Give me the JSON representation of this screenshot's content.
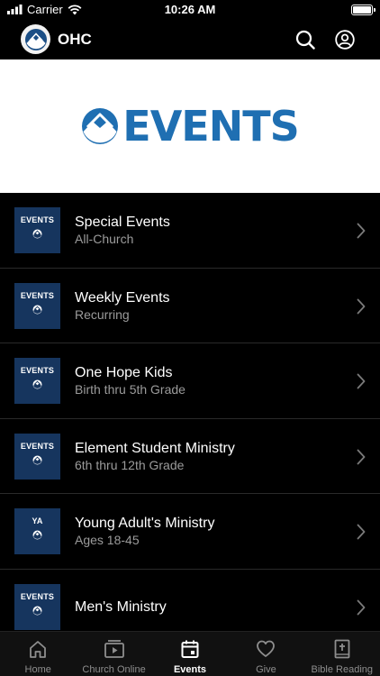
{
  "status_bar": {
    "carrier": "Carrier",
    "time": "10:26 AM"
  },
  "header": {
    "brand_name": "OHC"
  },
  "banner": {
    "title": "EVENTS",
    "color": "#1f6fb2"
  },
  "items": [
    {
      "thumb_label": "EVENTS",
      "title": "Special Events",
      "subtitle": "All-Church"
    },
    {
      "thumb_label": "EVENTS",
      "title": "Weekly Events",
      "subtitle": "Recurring"
    },
    {
      "thumb_label": "EVENTS",
      "title": "One Hope Kids",
      "subtitle": "Birth thru 5th Grade"
    },
    {
      "thumb_label": "EVENTS",
      "title": "Element Student Ministry",
      "subtitle": "6th thru 12th Grade"
    },
    {
      "thumb_label": "YA",
      "title": "Young Adult's Ministry",
      "subtitle": "Ages 18-45"
    },
    {
      "thumb_label": "EVENTS",
      "title": "Men's Ministry",
      "subtitle": ""
    }
  ],
  "tabs": [
    {
      "label": "Home",
      "icon": "home-icon"
    },
    {
      "label": "Church Online",
      "icon": "video-icon"
    },
    {
      "label": "Events",
      "icon": "calendar-icon",
      "active": true
    },
    {
      "label": "Give",
      "icon": "heart-icon"
    },
    {
      "label": "Bible Reading",
      "icon": "bible-icon"
    }
  ],
  "colors": {
    "thumb_bg": "#16355e",
    "accent": "#1f6fb2"
  }
}
